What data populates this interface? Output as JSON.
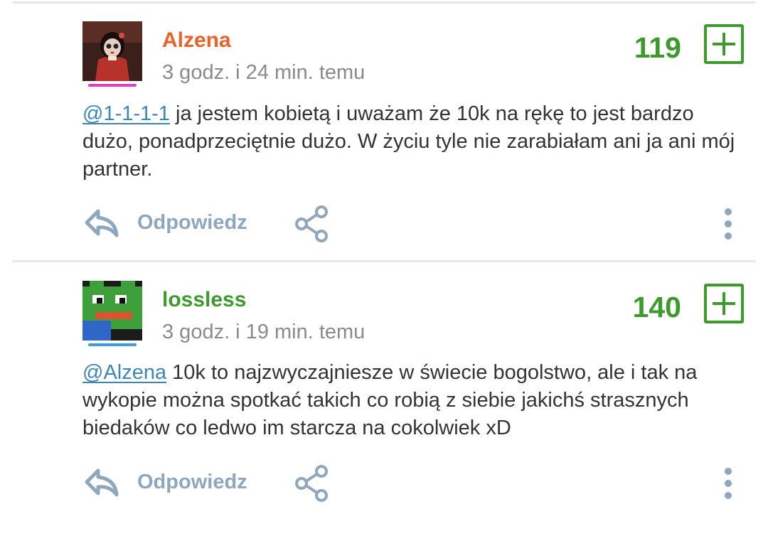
{
  "comments": [
    {
      "username": "Alzena",
      "username_color": "#e8632a",
      "avatar_underline_color": "#e040c0",
      "timestamp": "3 godz. i 24 min. temu",
      "score": "119",
      "mention": "@1-1-1-1",
      "text": " ja jestem kobietą i uważam że 10k na rękę to jest bardzo dużo, ponadprzeciętnie dużo. W życiu tyle nie zarabiałam ani ja ani mój partner.",
      "reply_label": "Odpowiedz"
    },
    {
      "username": "lossless",
      "username_color": "#3f9a2e",
      "avatar_underline_color": "#3d9be0",
      "timestamp": "3 godz. i 19 min. temu",
      "score": "140",
      "mention": "@Alzena",
      "text": " 10k to najzwyczajniesze w świecie bogolstwo, ale i tak na wykopie można spotkać takich co robią z siebie jakichś strasznych biedaków co ledwo im starcza na cokolwiek xD",
      "reply_label": "Odpowiedz"
    }
  ],
  "icons": {
    "reply": "reply-arrow-icon",
    "share": "share-icon",
    "more": "more-vertical-icon",
    "upvote": "plus-icon"
  },
  "colors": {
    "score": "#3f9a2e",
    "action": "#8fa7bd",
    "mention": "#3d86b8",
    "timestamp": "#8a8a8a"
  }
}
